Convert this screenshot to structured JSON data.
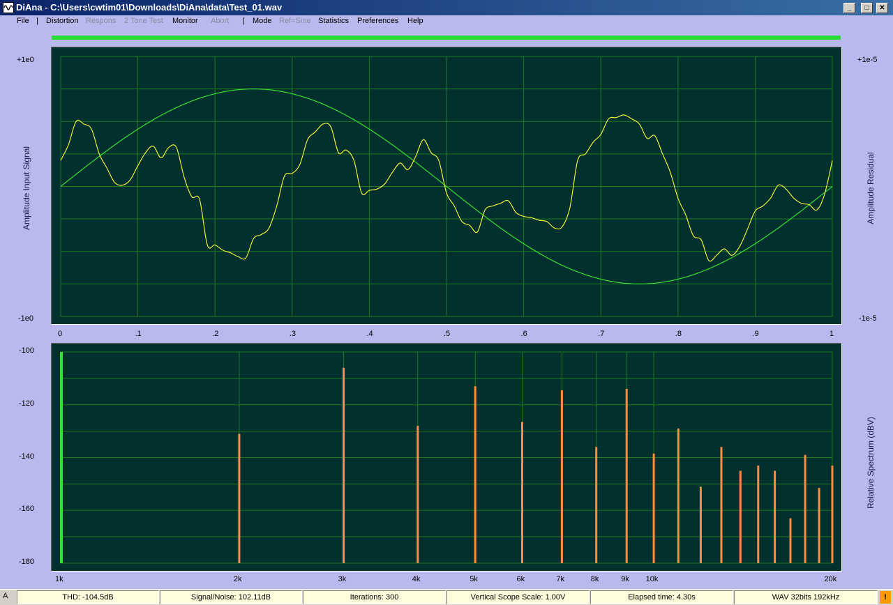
{
  "window": {
    "title": "DiAna - C:\\Users\\cwtim01\\Downloads\\DiAna\\data\\Test_01.wav"
  },
  "menu": {
    "file": "File",
    "sep1": "|",
    "distortion": "Distortion",
    "respons": "Respons",
    "two_tone": "2 Tone Test",
    "monitor": "Monitor",
    "abort": "Abort",
    "sep2": "|",
    "mode": "Mode",
    "ref_sine": "Ref=Sine",
    "statistics": "Statistics",
    "preferences": "Preferences",
    "help": "Help"
  },
  "scope": {
    "left_top": "+1e0",
    "left_bottom": "-1e0",
    "right_top": "+1e-5",
    "right_bottom": "-1e-5",
    "left_label": "Amplitude Input Signal",
    "right_label": "Amplitude Residual",
    "x_ticks": [
      "0",
      ".1",
      ".2",
      ".3",
      ".4",
      ".5",
      ".6",
      ".7",
      ".8",
      ".9",
      "1"
    ]
  },
  "spectrum": {
    "y_ticks": [
      "-100",
      "-120",
      "-140",
      "-160",
      "-180"
    ],
    "right_label": "Relative Spectrum  (dBV)",
    "x_ticks": [
      "1k",
      "2k",
      "3k",
      "4k",
      "5k",
      "6k",
      "7k",
      "8k",
      "9k",
      "10k",
      "20k"
    ]
  },
  "status": {
    "mode": "A",
    "thd": "THD: -104.5dB",
    "snr": "Signal/Noise: 102.11dB",
    "iterations": "Iterations: 300",
    "vscale": "Vertical Scope Scale: 1.00V",
    "elapsed": "Elapsed time: 4.30s",
    "format": "WAV 32bits 192kHz",
    "warn": "!"
  },
  "colors": {
    "scope_bg": "#02302e",
    "grid": "#1d7a1d",
    "sine": "#35e035",
    "residual": "#f0f03a",
    "bar": "#ff8c40",
    "progress": "#2cdd3a"
  },
  "chart_data": [
    {
      "type": "line",
      "xlim": [
        0,
        1
      ],
      "series": [
        {
          "axis": "left",
          "x": [
            0,
            0.05,
            0.1,
            0.15,
            0.2,
            0.25,
            0.3,
            0.35,
            0.4,
            0.45,
            0.5,
            0.55,
            0.6,
            0.65,
            0.7,
            0.75,
            0.8,
            0.85,
            0.9,
            0.95,
            1
          ],
          "y": [
            0,
            0.31,
            0.59,
            0.81,
            0.95,
            1,
            0.95,
            0.81,
            0.59,
            0.31,
            0,
            -0.31,
            -0.59,
            -0.81,
            -0.95,
            -1,
            -0.95,
            -0.81,
            -0.59,
            -0.31,
            0
          ]
        },
        {
          "axis": "right",
          "x": [
            0,
            0.01,
            0.02,
            0.03,
            0.04,
            0.05,
            0.06,
            0.07,
            0.08,
            0.09,
            0.1,
            0.11,
            0.12,
            0.13,
            0.14,
            0.15,
            0.16,
            0.17,
            0.18,
            0.19,
            0.2,
            0.21,
            0.22,
            0.23,
            0.24,
            0.25,
            0.26,
            0.27,
            0.28,
            0.29,
            0.3,
            0.31,
            0.32,
            0.33,
            0.34,
            0.35,
            0.36,
            0.37,
            0.38,
            0.39,
            0.4,
            0.41,
            0.42,
            0.43,
            0.44,
            0.45,
            0.46,
            0.47,
            0.48,
            0.49,
            0.5,
            0.51,
            0.52,
            0.53,
            0.54,
            0.55,
            0.56,
            0.57,
            0.58,
            0.59,
            0.6,
            0.61,
            0.62,
            0.63,
            0.64,
            0.65,
            0.66,
            0.67,
            0.68,
            0.69,
            0.7,
            0.71,
            0.72,
            0.73,
            0.74,
            0.75,
            0.76,
            0.77,
            0.78,
            0.79,
            0.8,
            0.81,
            0.82,
            0.83,
            0.84,
            0.85,
            0.86,
            0.87,
            0.88,
            0.89,
            0.9,
            0.91,
            0.92,
            0.93,
            0.94,
            0.95,
            0.96,
            0.97,
            0.98,
            0.99,
            1
          ],
          "y": [
            0.2,
            0.32,
            0.5,
            0.48,
            0.44,
            0.25,
            0.14,
            0.03,
            0.01,
            0.05,
            0.16,
            0.26,
            0.31,
            0.22,
            0.3,
            0.3,
            0.07,
            -0.08,
            -0.1,
            -0.45,
            -0.45,
            -0.49,
            -0.51,
            -0.54,
            -0.55,
            -0.4,
            -0.37,
            -0.32,
            -0.15,
            0.08,
            0.1,
            0.17,
            0.36,
            0.42,
            0.48,
            0.46,
            0.26,
            0.28,
            0.2,
            -0.05,
            -0.03,
            -0.02,
            0.02,
            0.11,
            0.18,
            0.13,
            0.23,
            0.36,
            0.26,
            0.2,
            -0.05,
            -0.15,
            -0.27,
            -0.3,
            -0.35,
            -0.18,
            -0.15,
            -0.13,
            -0.11,
            -0.2,
            -0.23,
            -0.24,
            -0.26,
            -0.27,
            -0.32,
            -0.31,
            -0.16,
            0.2,
            0.25,
            0.34,
            0.4,
            0.52,
            0.53,
            0.55,
            0.52,
            0.48,
            0.37,
            0.39,
            0.25,
            0.11,
            -0.09,
            -0.22,
            -0.38,
            -0.41,
            -0.57,
            -0.53,
            -0.48,
            -0.53,
            -0.46,
            -0.33,
            -0.19,
            -0.15,
            -0.09,
            0.01,
            -0.02,
            -0.09,
            -0.13,
            -0.14,
            -0.18,
            -0.06,
            0.2
          ]
        }
      ]
    },
    {
      "type": "bar",
      "xscale": "log",
      "xlim": [
        1000,
        20000
      ],
      "ylim": [
        -180,
        -100
      ],
      "x": [
        1000,
        2000,
        3000,
        4000,
        5000,
        6000,
        7000,
        8000,
        9000,
        10000,
        11000,
        12000,
        13000,
        14000,
        15000,
        16000,
        17000,
        18000,
        19000,
        20000
      ],
      "values": [
        -100,
        -131,
        -106,
        -128,
        -113,
        -126.5,
        -114.5,
        -136,
        -114,
        -138.5,
        -129,
        -151,
        -136,
        -145,
        -143,
        -145,
        -163,
        -139,
        -151.5,
        -143
      ]
    }
  ]
}
